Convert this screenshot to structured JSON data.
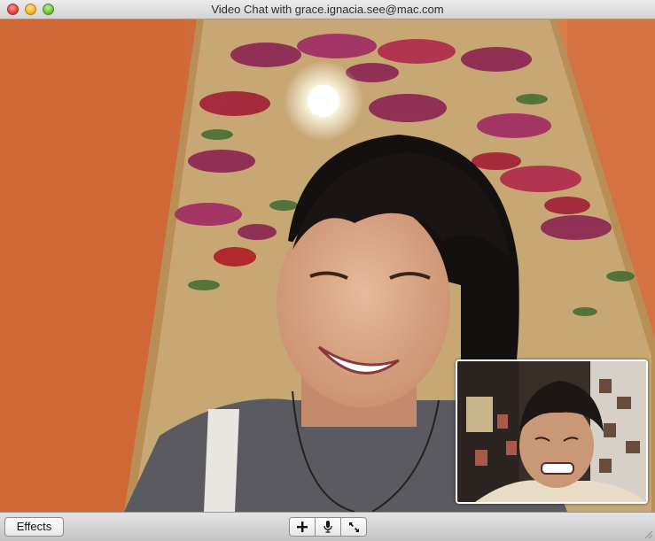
{
  "window": {
    "title": "Video Chat with grace.ignacia.see@mac.com"
  },
  "toolbar": {
    "effects_label": "Effects",
    "buttons": [
      {
        "name": "add",
        "icon": "plus-icon"
      },
      {
        "name": "mute",
        "icon": "microphone-icon"
      },
      {
        "name": "fullscreen",
        "icon": "fullscreen-arrows-icon"
      }
    ]
  },
  "colors": {
    "wall": "#d06a3a",
    "frame_bg": "#c9b47e",
    "accent_red": "#a02030"
  }
}
